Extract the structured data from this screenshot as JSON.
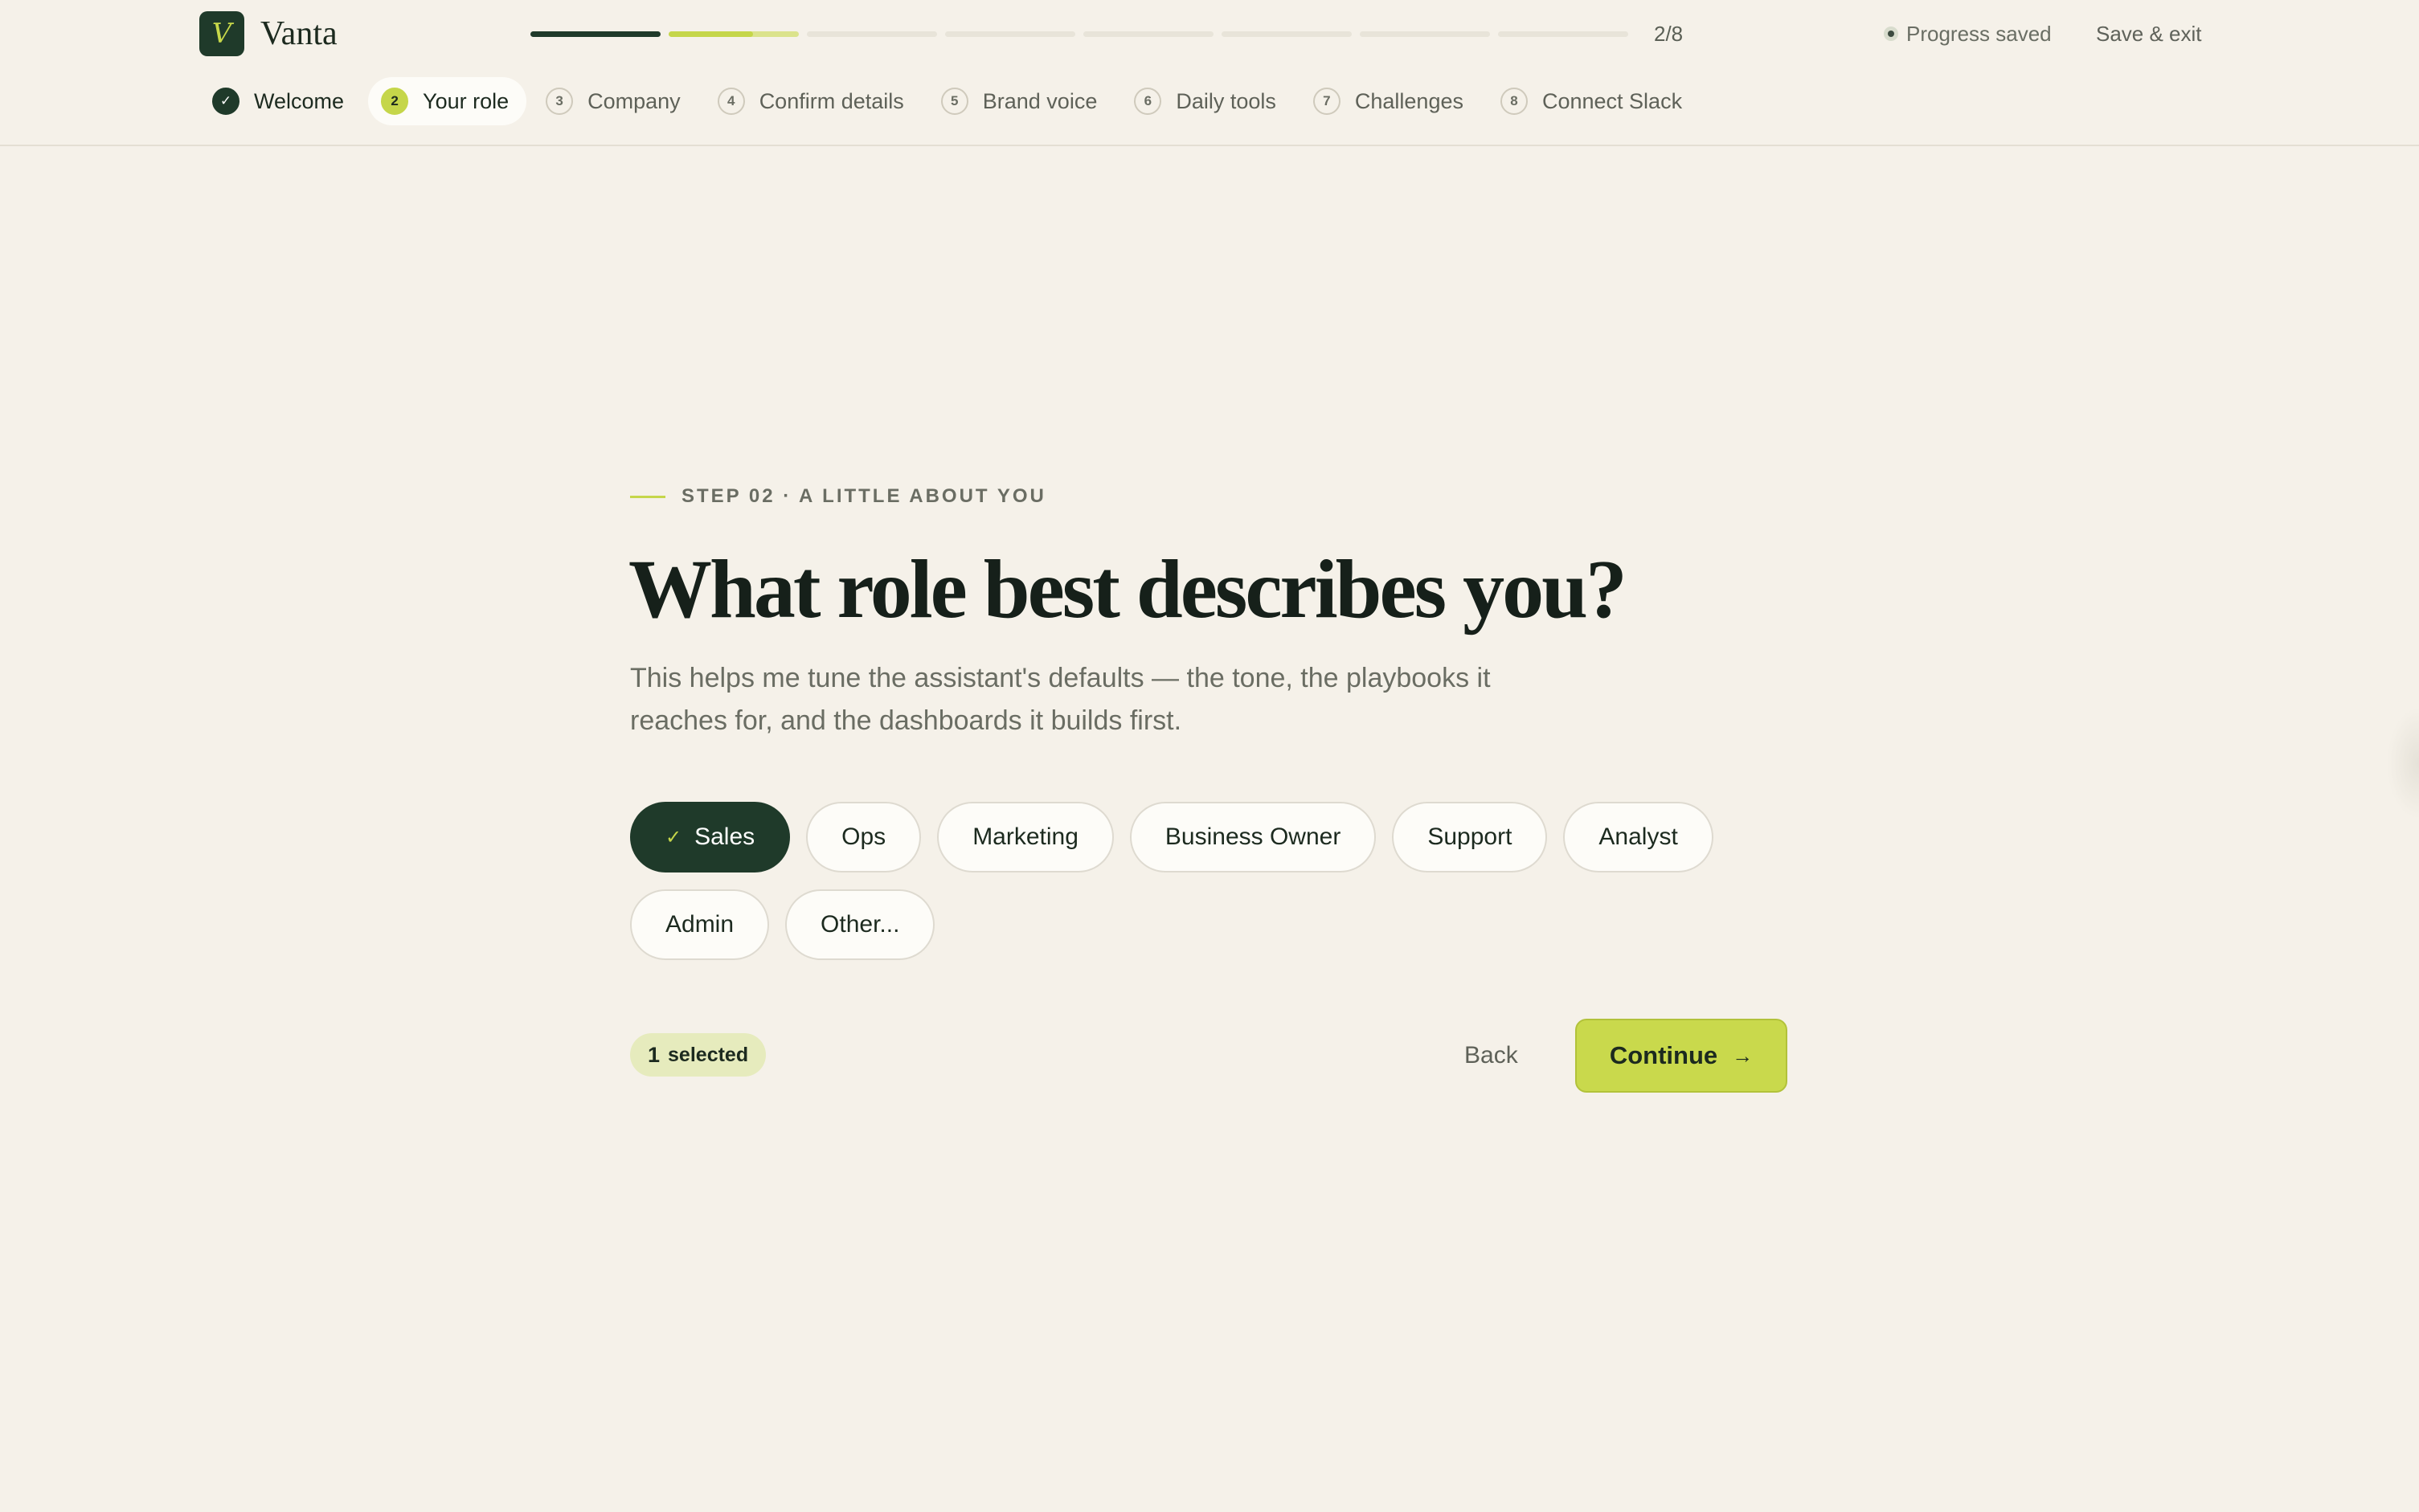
{
  "app": {
    "brand": "Vanta",
    "logo_letter": "V"
  },
  "progress": {
    "counter": "2/8",
    "segments": [
      {
        "state": "done",
        "fill": 1.0
      },
      {
        "state": "current",
        "fill": 0.65
      },
      {
        "state": "todo",
        "fill": 0
      },
      {
        "state": "todo",
        "fill": 0
      },
      {
        "state": "todo",
        "fill": 0
      },
      {
        "state": "todo",
        "fill": 0
      },
      {
        "state": "todo",
        "fill": 0
      },
      {
        "state": "todo",
        "fill": 0
      }
    ],
    "status": "Progress saved",
    "save_exit": "Save & exit"
  },
  "steps": [
    {
      "num": "✓",
      "label": "Welcome",
      "state": "done"
    },
    {
      "num": "2",
      "label": "Your role",
      "state": "active"
    },
    {
      "num": "3",
      "label": "Company",
      "state": "todo"
    },
    {
      "num": "4",
      "label": "Confirm details",
      "state": "todo"
    },
    {
      "num": "5",
      "label": "Brand voice",
      "state": "todo"
    },
    {
      "num": "6",
      "label": "Daily tools",
      "state": "todo"
    },
    {
      "num": "7",
      "label": "Challenges",
      "state": "todo"
    },
    {
      "num": "8",
      "label": "Connect Slack",
      "state": "todo"
    }
  ],
  "main": {
    "eyebrow": "STEP 02 · A LITTLE ABOUT YOU",
    "title": "What role best describes you?",
    "subtitle": "This helps me tune the assistant's defaults — the tone, the playbooks it reaches for, and the dashboards it builds first.",
    "roles": [
      {
        "label": "Sales",
        "selected": true
      },
      {
        "label": "Ops",
        "selected": false
      },
      {
        "label": "Marketing",
        "selected": false
      },
      {
        "label": "Business Owner",
        "selected": false
      },
      {
        "label": "Support",
        "selected": false
      },
      {
        "label": "Analyst",
        "selected": false
      },
      {
        "label": "Admin",
        "selected": false
      },
      {
        "label": "Other...",
        "selected": false
      }
    ],
    "selected_count": "1",
    "selected_label": "selected",
    "back_label": "Back",
    "continue_label": "Continue",
    "check_icon": "✓",
    "arrow_icon": "→"
  },
  "colors": {
    "background": "#f5f1e9",
    "primary": "#1f3a2a",
    "accent": "#c9d94c",
    "muted_text": "#6a6d63"
  }
}
